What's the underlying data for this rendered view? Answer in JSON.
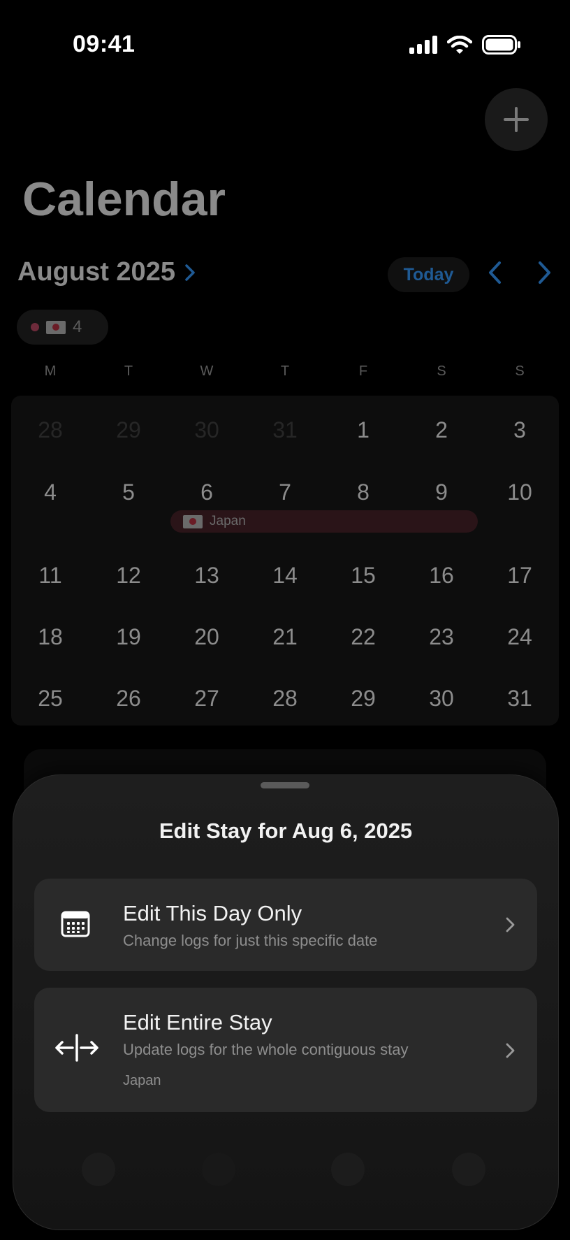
{
  "status_bar": {
    "time": "09:41"
  },
  "header": {
    "title": "Calendar",
    "add_label": "+"
  },
  "month_nav": {
    "month": "August 2025",
    "today_label": "Today"
  },
  "country_chip": {
    "count": "4"
  },
  "weekdays": [
    "M",
    "T",
    "W",
    "T",
    "F",
    "S",
    "S"
  ],
  "calendar": {
    "weeks": [
      [
        "28",
        "29",
        "30",
        "31",
        "1",
        "2",
        "3"
      ],
      [
        "4",
        "5",
        "6",
        "7",
        "8",
        "9",
        "10"
      ],
      [
        "11",
        "12",
        "13",
        "14",
        "15",
        "16",
        "17"
      ],
      [
        "18",
        "19",
        "20",
        "21",
        "22",
        "23",
        "24"
      ],
      [
        "25",
        "26",
        "27",
        "28",
        "29",
        "30",
        "31"
      ]
    ],
    "stay_label": "Japan"
  },
  "sheet": {
    "title": "Edit Stay for Aug 6, 2025",
    "option_day": {
      "title": "Edit This Day Only",
      "subtitle": "Change logs for just this specific date"
    },
    "option_stay": {
      "title": "Edit Entire Stay",
      "subtitle": "Update logs for the whole contiguous stay",
      "note": "Japan"
    }
  },
  "colors": {
    "accent": "#1f5a94",
    "sheet_background": "#1e1e1e",
    "option_background": "#2a2a2a",
    "stay_bar": "#2a1418"
  },
  "icons": {
    "add": "plus-icon",
    "day": "calendar-icon",
    "stay": "expand-horizontal-icon",
    "chevron": "chevron-right-icon"
  }
}
